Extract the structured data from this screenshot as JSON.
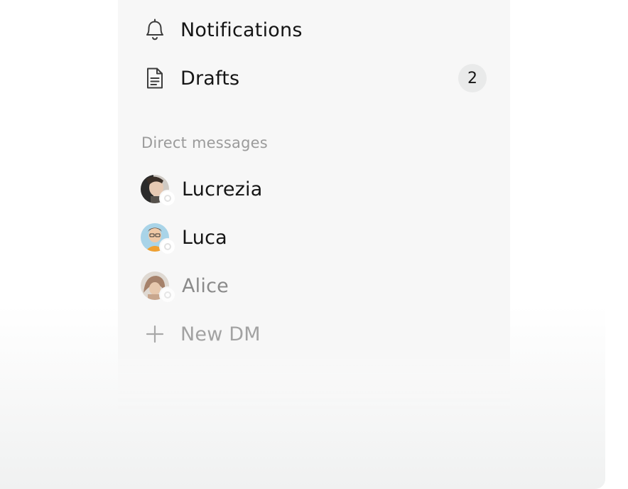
{
  "nav": {
    "notifications_label": "Notifications",
    "drafts_label": "Drafts",
    "drafts_count": "2"
  },
  "direct_messages": {
    "title": "Direct messages",
    "contacts": [
      {
        "name": "Lucrezia",
        "icon": "avatar-lucrezia"
      },
      {
        "name": "Luca",
        "icon": "avatar-luca"
      },
      {
        "name": "Alice",
        "icon": "avatar-alice"
      }
    ],
    "new_dm_label": "New DM"
  },
  "colors": {
    "panel": "#f7f7f7",
    "text": "#151515",
    "muted": "#9b9b9b",
    "badge": "#e9eaea"
  }
}
